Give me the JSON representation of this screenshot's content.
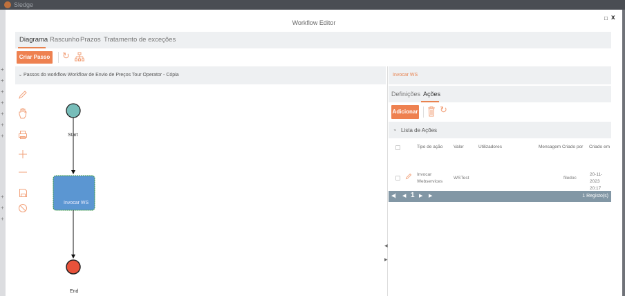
{
  "app": {
    "brand": "Sledge"
  },
  "modal": {
    "title": "Workflow Editor",
    "minimize_icon": "square-icon",
    "close_label": "x"
  },
  "tabs": [
    {
      "label": "Diagrama",
      "active": true
    },
    {
      "label": "Rascunho",
      "active": false
    },
    {
      "label": "Prazos",
      "active": false
    },
    {
      "label": "Tratamento de exceções",
      "active": false
    }
  ],
  "toolbar": {
    "create_step_label": "Criar Passo",
    "refresh_icon": "refresh-icon",
    "hierarchy_icon": "hierarchy-icon"
  },
  "left_panel": {
    "title": "Passos do workflow Workflow de Envio de Preços Tour Operator - Cópia",
    "tools": [
      "pencil-icon",
      "hand-icon",
      "print-icon",
      "zoom-in-icon",
      "zoom-out-icon",
      "save-icon",
      "cancel-icon"
    ]
  },
  "diagram": {
    "start_label": "Start",
    "task_label": "Invocar WS",
    "end_label": "End",
    "colors": {
      "start": "#77bdb9",
      "task": "#5b96d2",
      "end": "#e8523a"
    }
  },
  "right_panel": {
    "header": "Invocar WS",
    "tabs": [
      {
        "label": "Definições",
        "active": false
      },
      {
        "label": "Ações",
        "active": true
      }
    ],
    "add_label": "Adicionar",
    "actions_list_label": "Lista de Ações",
    "columns": [
      "Tipo de ação",
      "Valor",
      "Utilizadores",
      "Mensagem",
      "Criado por",
      "Criado em"
    ],
    "rows": [
      {
        "type_line1": "Invocar",
        "type_line2": "Webservices",
        "value": "WSTest",
        "users": "",
        "message": "",
        "created_by": "filedoc",
        "created_on_line1": "20-11-2023",
        "created_on_line2": "20:17"
      }
    ],
    "pager": {
      "page": "1",
      "count": "1 Registo(s)"
    }
  },
  "colors": {
    "accent": "#ee8150",
    "header_bg": "#eef0f2",
    "pager_bg": "#8297a5"
  }
}
